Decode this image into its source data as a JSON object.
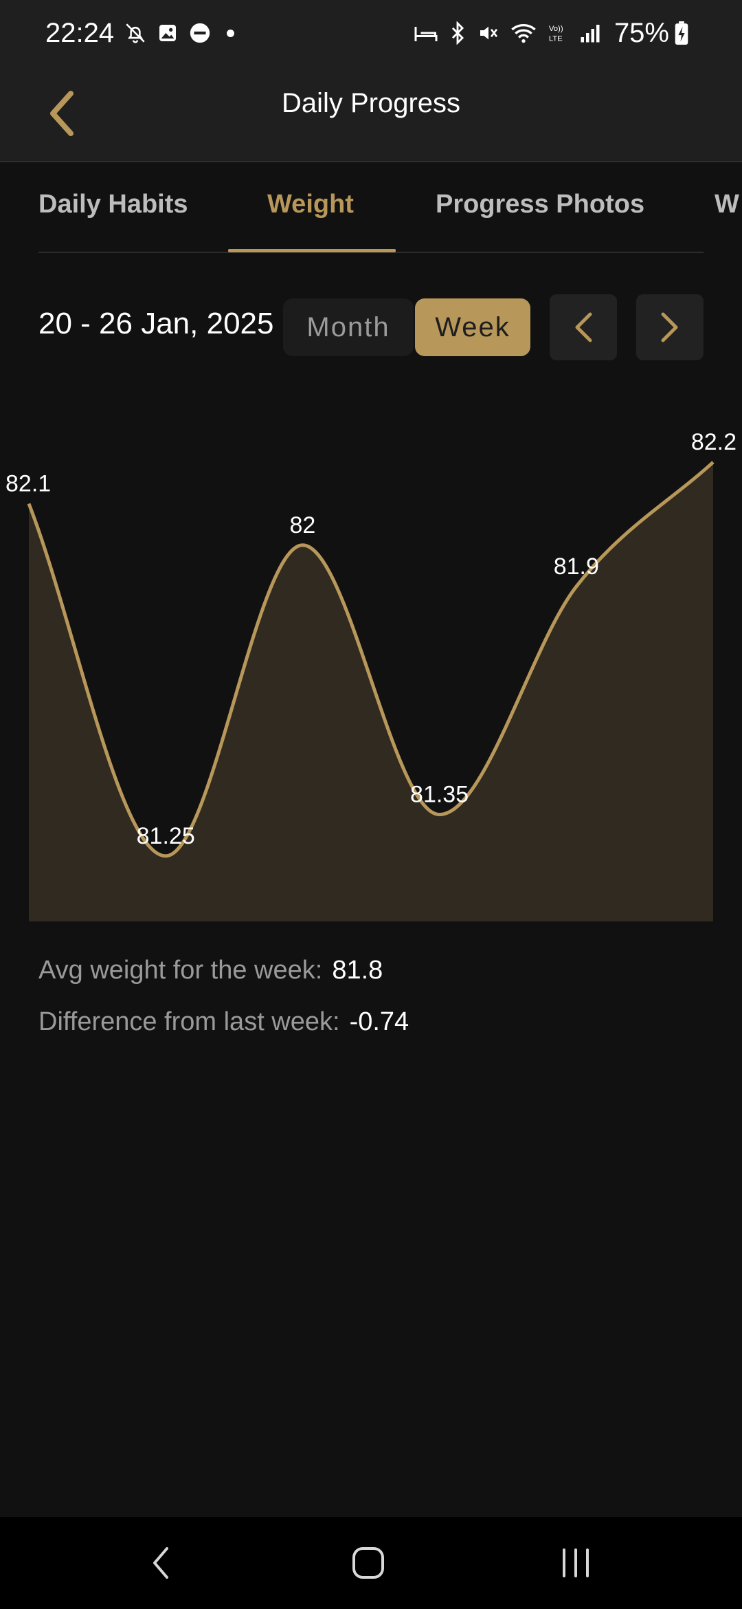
{
  "status_bar": {
    "time": "22:24",
    "battery": "75%",
    "icons_left": [
      "notifications-off-icon",
      "gallery-icon",
      "do-not-disturb-icon",
      "dot-icon"
    ],
    "icons_right": [
      "sleep-mode-icon",
      "bluetooth-icon",
      "mute-icon",
      "wifi-icon",
      "volte-icon",
      "signal-icon",
      "battery-charging-icon"
    ]
  },
  "app_bar": {
    "title": "Daily Progress"
  },
  "tabs": [
    {
      "label": "Daily Habits",
      "active": false
    },
    {
      "label": "Weight",
      "active": true
    },
    {
      "label": "Progress Photos",
      "active": false
    },
    {
      "label": "W",
      "active": false
    }
  ],
  "period": {
    "range_label": "20 - 26 Jan, 2025",
    "options": [
      "Month",
      "Week"
    ],
    "selected": "Week"
  },
  "chart_data": {
    "type": "area",
    "values": [
      82.1,
      81.25,
      82,
      81.35,
      81.9,
      82.2
    ],
    "labels": [
      "82.1",
      "81.25",
      "82",
      "81.35",
      "81.9",
      "82.2"
    ],
    "line_color": "#b8975a",
    "fill_color": "#302a20",
    "grid": false
  },
  "stats": {
    "avg_label": "Avg weight for the week:",
    "avg_value": "81.8",
    "diff_label": "Difference from last week:",
    "diff_value": "-0.74"
  },
  "colors": {
    "accent": "#b8975a",
    "background": "#111111",
    "bar": "#1f1f1f"
  }
}
